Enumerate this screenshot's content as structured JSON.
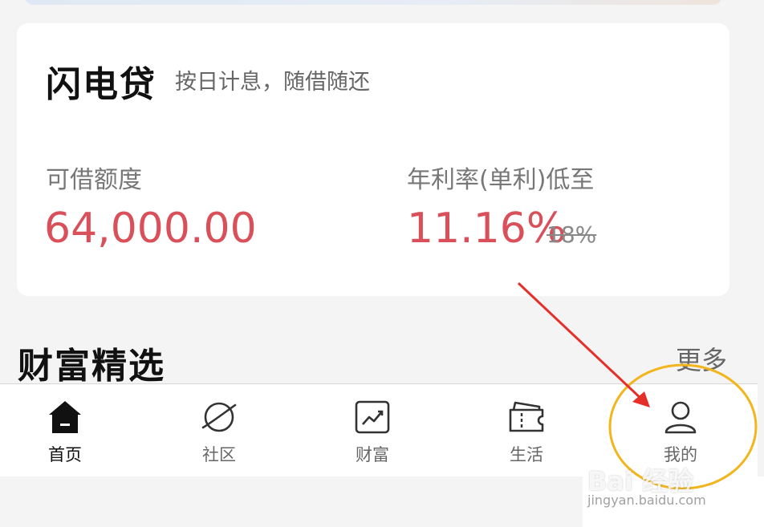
{
  "loan": {
    "title": "闪电贷",
    "subtitle": "按日计息，随借随还",
    "quota_label": "可借额度",
    "quota_value": "64,000.00",
    "rate_label": "年利率(单利)低至",
    "rate_value": "11.16%",
    "rate_old": "18%"
  },
  "wealth_section": {
    "title": "财富精选",
    "more": "更多"
  },
  "tabbar": {
    "items": [
      {
        "label": "首页",
        "icon": "home-icon",
        "active": true
      },
      {
        "label": "社区",
        "icon": "planet-icon",
        "active": false
      },
      {
        "label": "财富",
        "icon": "trend-chart-icon",
        "active": false
      },
      {
        "label": "生活",
        "icon": "ticket-icon",
        "active": false
      },
      {
        "label": "我的",
        "icon": "user-icon",
        "active": false
      }
    ]
  },
  "annotation": {
    "arrow_color": "#e5302a",
    "circle_color": "#f3b51e"
  },
  "watermark": {
    "brand": "Bai 经验",
    "url": "jingyan.baidu.com"
  },
  "colors": {
    "accent_red": "#d9505a",
    "text_dark": "#111111",
    "text_gray": "#777777"
  }
}
